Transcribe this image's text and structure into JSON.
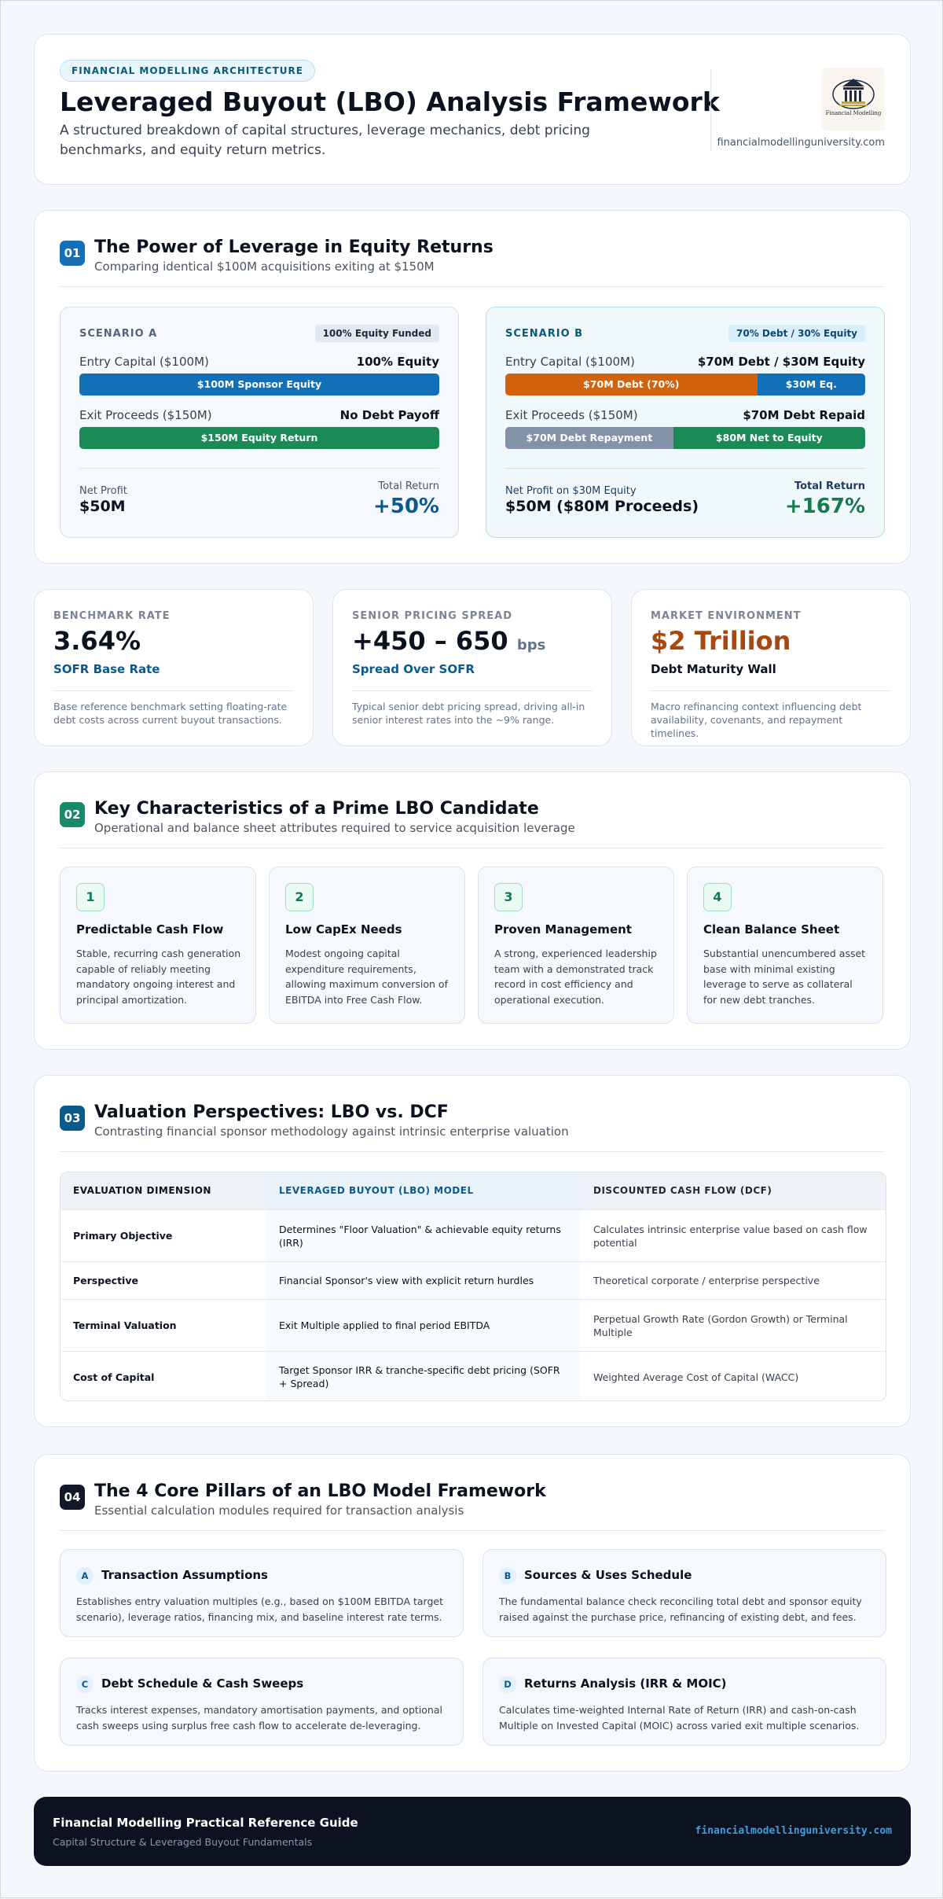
{
  "header": {
    "pill": "FINANCIAL MODELLING ARCHITECTURE",
    "title": "Leveraged Buyout (LBO) Analysis Framework",
    "subtitle": "A structured breakdown of capital structures, leverage mechanics, debt pricing benchmarks, and equity return metrics.",
    "logo_caption": "Financial Modelling",
    "url": "financialmodellinguniversity.com"
  },
  "section1": {
    "number": "01",
    "title": "The Power of Leverage in Equity Returns",
    "subtitle": "Comparing identical $100M acquisitions exiting at $150M",
    "scenario_a": {
      "label": "SCENARIO A",
      "badge": "100% Equity Funded",
      "entry_label": "Entry Capital ($100M)",
      "entry_value": "100% Equity",
      "entry_bar": [
        {
          "label": "$100M Sponsor Equity",
          "share": 1.0,
          "color": "#1170b8"
        }
      ],
      "exit_label": "Exit Proceeds ($150M)",
      "exit_value": "No Debt Payoff",
      "exit_bar": [
        {
          "label": "$150M Equity Return",
          "share": 1.0,
          "color": "#1a8a57"
        }
      ],
      "profit_label": "Net Profit",
      "profit_value": "$50M",
      "return_label": "Total Return",
      "return_value": "+50%"
    },
    "scenario_b": {
      "label": "SCENARIO B",
      "badge": "70% Debt / 30% Equity",
      "entry_label": "Entry Capital ($100M)",
      "entry_value": "$70M Debt / $30M Equity",
      "entry_bar": [
        {
          "label": "$70M Debt (70%)",
          "share": 0.7,
          "color": "#d3620c"
        },
        {
          "label": "$30M Eq.",
          "share": 0.3,
          "color": "#1170b8"
        }
      ],
      "exit_label": "Exit Proceeds ($150M)",
      "exit_value": "$70M Debt Repaid",
      "exit_bar": [
        {
          "label": "$70M Debt Repayment",
          "share": 0.4667,
          "color": "#8292a8"
        },
        {
          "label": "$80M Net to Equity",
          "share": 0.5333,
          "color": "#1a8a57"
        }
      ],
      "profit_label": "Net Profit on $30M Equity",
      "profit_value": "$50M ($80M Proceeds)",
      "return_label": "Total Return",
      "return_value": "+167%"
    }
  },
  "metrics": [
    {
      "label": "BENCHMARK RATE",
      "value": "3.64%",
      "unit": "",
      "caption": "SOFR Base Rate",
      "description": "Base reference benchmark setting floating-rate debt costs across current buyout transactions."
    },
    {
      "label": "SENIOR PRICING SPREAD",
      "value": "+450 – 650",
      "unit": "bps",
      "caption": "Spread Over SOFR",
      "description": "Typical senior debt pricing spread, driving all-in senior interest rates into the ~9% range."
    },
    {
      "label": "MARKET ENVIRONMENT",
      "value": "$2 Trillion",
      "unit": "",
      "caption": "Debt Maturity Wall",
      "description": "Macro refinancing context influencing debt availability, covenants, and repayment timelines."
    }
  ],
  "section2": {
    "number": "02",
    "title": "Key Characteristics of a Prime LBO Candidate",
    "subtitle": "Operational and balance sheet attributes required to service acquisition leverage",
    "items": [
      {
        "n": "1",
        "title": "Predictable Cash Flow",
        "description": "Stable, recurring cash generation capable of reliably meeting mandatory ongoing interest and principal amortization."
      },
      {
        "n": "2",
        "title": "Low CapEx Needs",
        "description": "Modest ongoing capital expenditure requirements, allowing maximum conversion of EBITDA into Free Cash Flow."
      },
      {
        "n": "3",
        "title": "Proven Management",
        "description": "A strong, experienced leadership team with a demonstrated track record in cost efficiency and operational execution."
      },
      {
        "n": "4",
        "title": "Clean Balance Sheet",
        "description": "Substantial unencumbered asset base with minimal existing leverage to serve as collateral for new debt tranches."
      }
    ]
  },
  "section3": {
    "number": "03",
    "title": "Valuation Perspectives: LBO vs. DCF",
    "subtitle": "Contrasting financial sponsor methodology against intrinsic enterprise valuation",
    "headers": [
      "EVALUATION DIMENSION",
      "LEVERAGED BUYOUT (LBO) MODEL",
      "DISCOUNTED CASH FLOW (DCF)"
    ],
    "rows": [
      [
        "Primary Objective",
        "Determines \"Floor Valuation\" & achievable equity returns (IRR)",
        "Calculates intrinsic enterprise value based on cash flow potential"
      ],
      [
        "Perspective",
        "Financial Sponsor's view with explicit return hurdles",
        "Theoretical corporate / enterprise perspective"
      ],
      [
        "Terminal Valuation",
        "Exit Multiple applied to final period EBITDA",
        "Perpetual Growth Rate (Gordon Growth) or Terminal Multiple"
      ],
      [
        "Cost of Capital",
        "Target Sponsor IRR & tranche-specific debt pricing (SOFR + Spread)",
        "Weighted Average Cost of Capital (WACC)"
      ]
    ]
  },
  "section4": {
    "number": "04",
    "title": "The 4 Core Pillars of an LBO Model Framework",
    "subtitle": "Essential calculation modules required for transaction analysis",
    "pillars": [
      {
        "badge": "A",
        "title": "Transaction Assumptions",
        "description": "Establishes entry valuation multiples (e.g., based on $100M EBITDA target scenario), leverage ratios, financing mix, and baseline interest rate terms."
      },
      {
        "badge": "B",
        "title": "Sources & Uses Schedule",
        "description": "The fundamental balance check reconciling total debt and sponsor equity raised against the purchase price, refinancing of existing debt, and fees."
      },
      {
        "badge": "C",
        "title": "Debt Schedule & Cash Sweeps",
        "description": "Tracks interest expenses, mandatory amortisation payments, and optional cash sweeps using surplus free cash flow to accelerate de-leveraging."
      },
      {
        "badge": "D",
        "title": "Returns Analysis (IRR & MOIC)",
        "description": "Calculates time-weighted Internal Rate of Return (IRR) and cash-on-cash Multiple on Invested Capital (MOIC) across varied exit multiple scenarios."
      }
    ]
  },
  "footer": {
    "title": "Financial Modelling Practical Reference Guide",
    "subtitle": "Capital Structure & Leveraged Buyout Fundamentals",
    "url": "financialmodellinguniversity.com"
  },
  "colors": {
    "primary_blue": "#1170b8",
    "debt_orange": "#d3620c",
    "equity_green": "#1a8a57",
    "repayment_grey": "#8292a8",
    "market_accent": "#a8470f",
    "footer_bg": "#0c1220"
  }
}
